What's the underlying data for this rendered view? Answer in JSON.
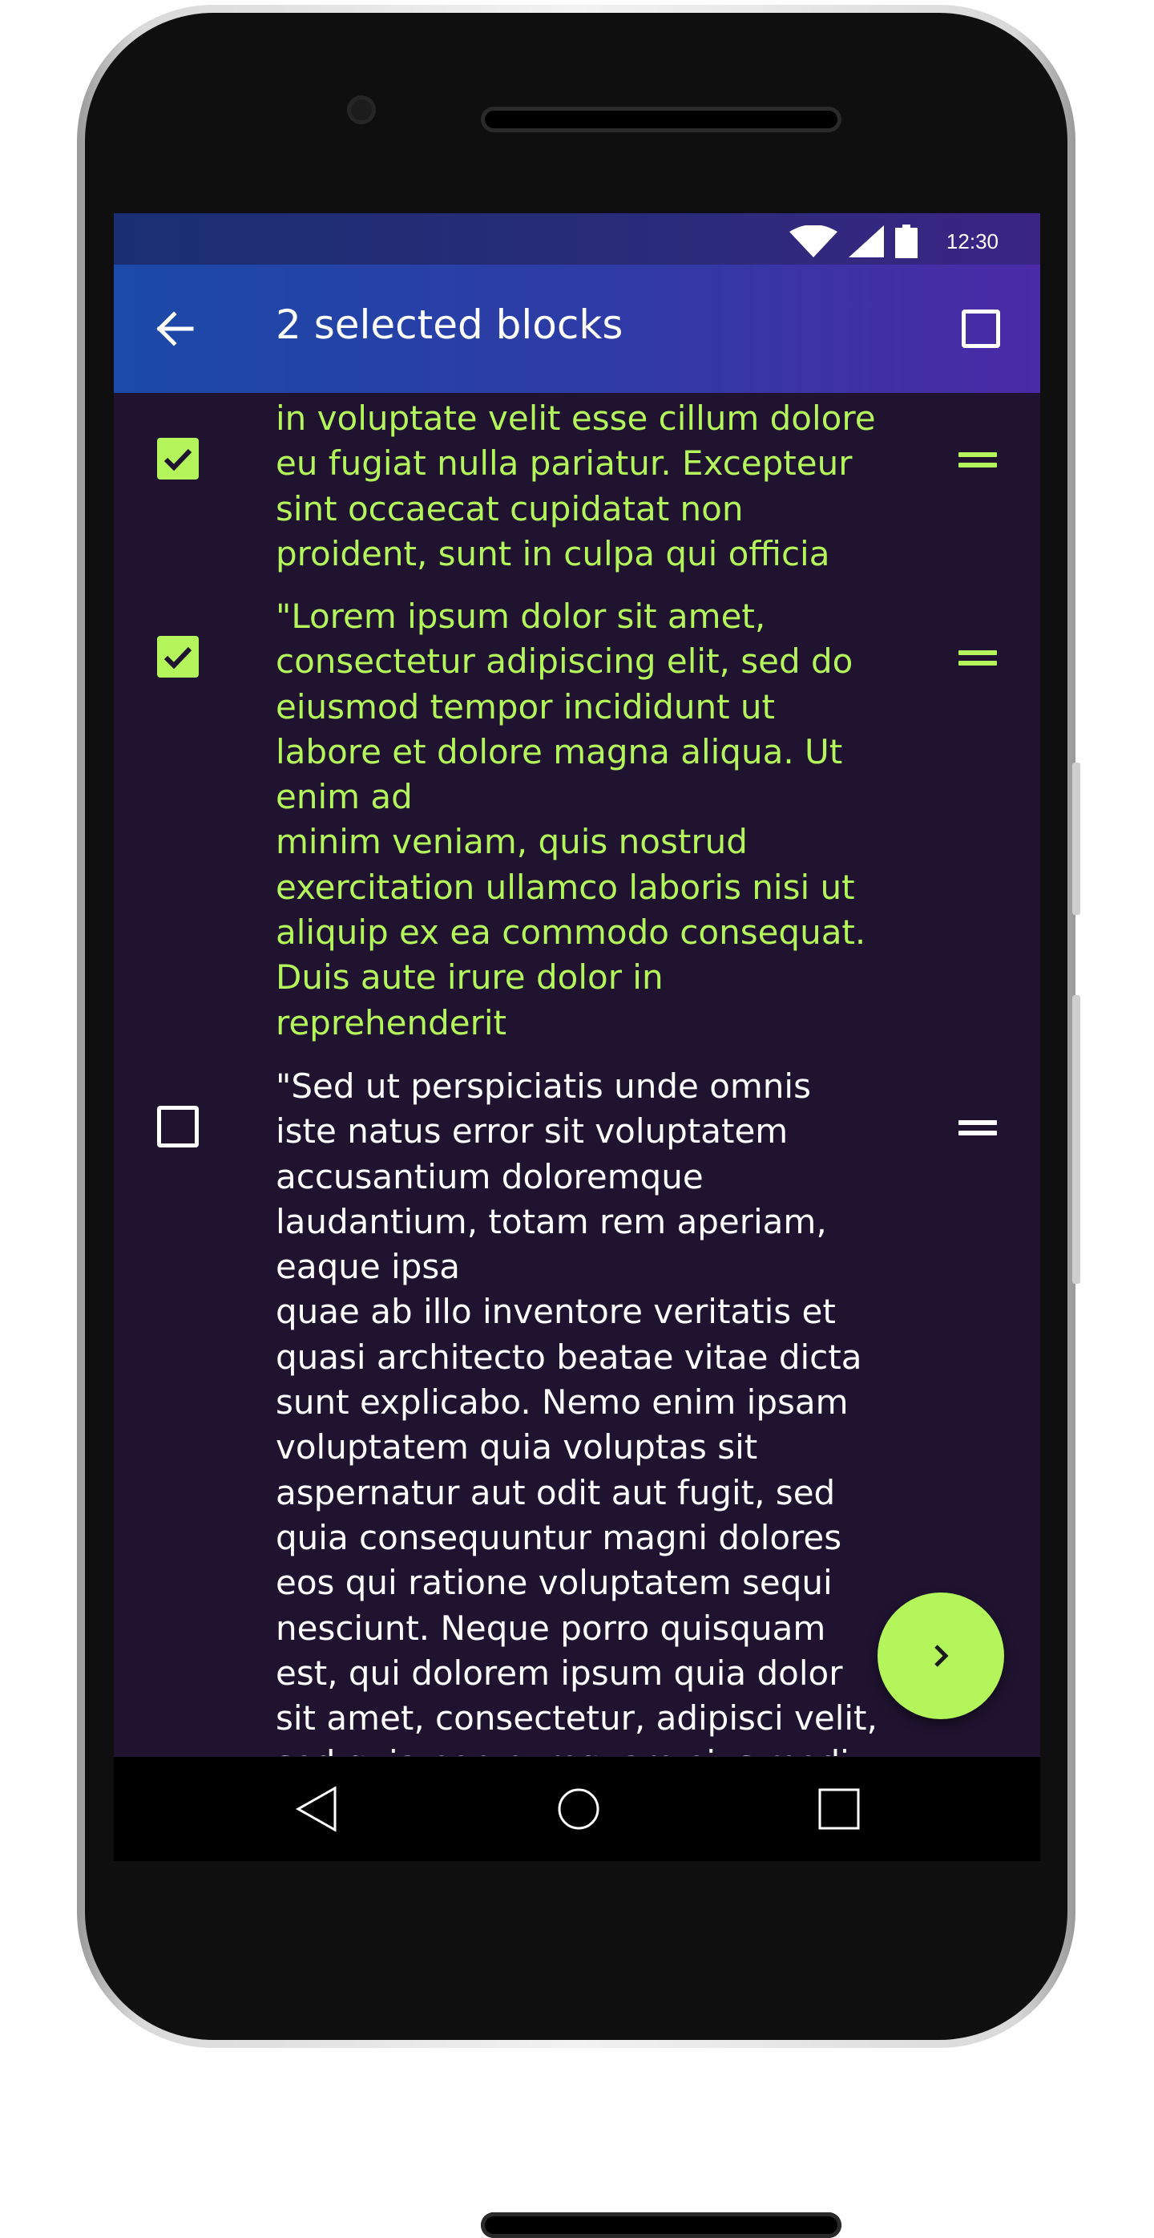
{
  "status_bar": {
    "time": "12:30",
    "icons": [
      "wifi-icon",
      "cell-signal-icon",
      "battery-icon"
    ]
  },
  "app_bar": {
    "title": "2 selected blocks",
    "back_icon": "arrow-left-icon",
    "action_icon": "checkbox-outline-icon"
  },
  "blocks": [
    {
      "checked": true,
      "text": "in voluptate velit esse cillum dolore\neu fugiat nulla pariatur. Excepteur\nsint occaecat cupidatat non\nproident, sunt in culpa qui officia"
    },
    {
      "checked": true,
      "text": "\"Lorem ipsum dolor sit amet,\nconsectetur adipiscing elit, sed do\neiusmod tempor incididunt ut\nlabore et dolore magna aliqua. Ut\nenim ad\nminim veniam, quis nostrud\nexercitation ullamco laboris nisi ut\naliquip ex ea commodo consequat.\nDuis aute irure dolor in\nreprehenderit"
    },
    {
      "checked": false,
      "text": "\"Sed ut perspiciatis unde omnis\niste natus error sit voluptatem\naccusantium doloremque\nlaudantium, totam rem aperiam,\neaque ipsa\nquae ab illo inventore veritatis et\nquasi architecto beatae vitae dicta\nsunt explicabo. Nemo enim ipsam\nvoluptatem quia voluptas sit\naspernatur aut odit aut fugit, sed\nquia consequuntur magni dolores\neos qui ratione voluptatem sequi\nnesciunt. Neque porro quisquam\nest, qui dolorem ipsum quia dolor\nsit amet, consectetur, adipisci velit,\nsed quia non numquam eius modi"
    }
  ],
  "fab": {
    "icon": "chevron-right-icon"
  },
  "nav_bar": {
    "icons": [
      "nav-back-icon",
      "nav-home-icon",
      "nav-recents-icon"
    ]
  },
  "colors": {
    "accent": "#b3f55a",
    "background": "#1f1330",
    "app_bar_start": "#1b4aa8",
    "app_bar_end": "#4a2aa6"
  }
}
